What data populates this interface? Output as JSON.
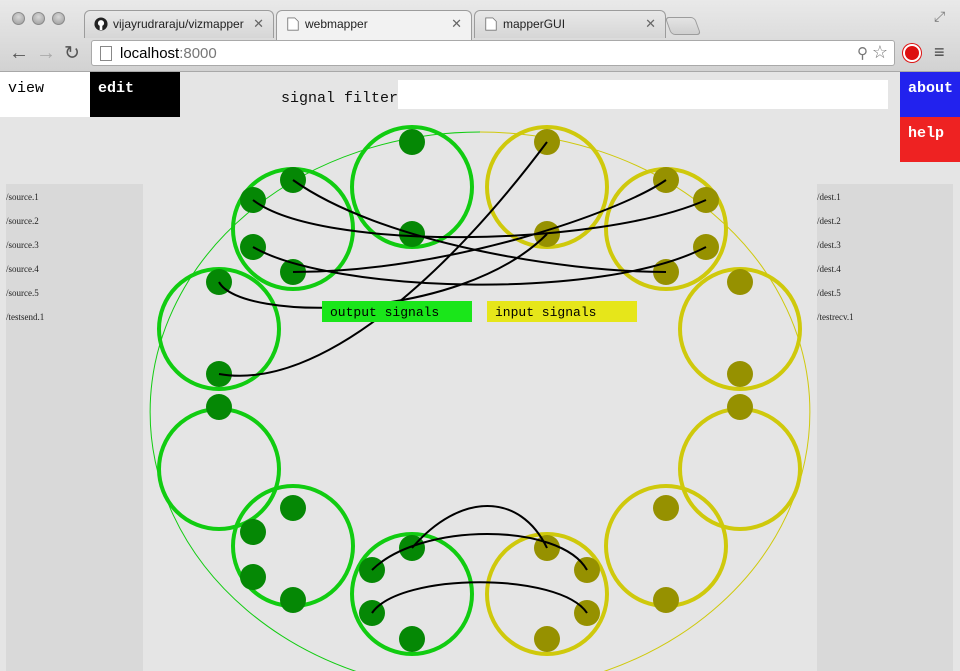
{
  "browser": {
    "tabs": [
      {
        "title": "vijayrudraraju/vizmapper",
        "icon": "github-icon",
        "active": false
      },
      {
        "title": "webmapper",
        "icon": "page-icon",
        "active": true
      },
      {
        "title": "mapperGUI",
        "icon": "page-icon",
        "active": false
      }
    ],
    "url_host": "localhost",
    "url_port": ":8000",
    "colors": {
      "close_button": "#d11111"
    }
  },
  "toolbar": {
    "view_label": "view",
    "edit_label": "edit",
    "filter_label": "signal filter",
    "filter_value": "",
    "about_label": "about",
    "help_label": "help"
  },
  "sources": [
    "/source.1",
    "/source.2",
    "/source.3",
    "/source.4",
    "/source.5",
    "/testsend.1"
  ],
  "destinations": [
    "/dest.1",
    "/dest.2",
    "/dest.3",
    "/dest.4",
    "/dest.5",
    "/testrecv.1"
  ],
  "legend": {
    "output_label": "output signals",
    "input_label": "input signals"
  },
  "colors": {
    "output": "#11cc11",
    "output_node": "#058805",
    "output_fill": "#1ae61a",
    "input": "#cfc90c",
    "input_node": "#969100",
    "input_fill": "#e6e61a",
    "about": "#2222ee",
    "help": "#ee2222"
  }
}
